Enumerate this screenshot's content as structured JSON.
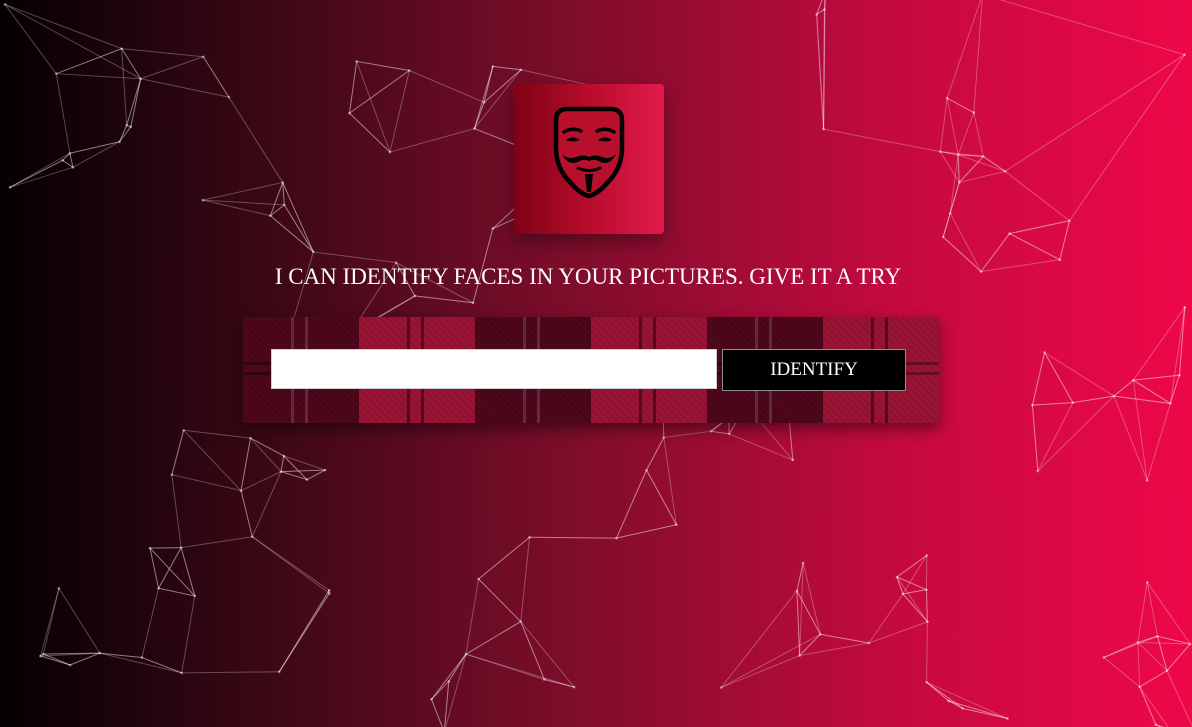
{
  "logo": {
    "icon": "guy-fawkes-mask-icon"
  },
  "headline": "I CAN IDENTIFY FACES IN YOUR PICTURES. GIVE IT A TRY",
  "search": {
    "value": "",
    "placeholder": ""
  },
  "identify_button": {
    "label": "IDENTIFY"
  },
  "colors": {
    "background_left": "#050003",
    "background_right": "#ee0848",
    "logo_box_left": "#7d0314",
    "logo_box_right": "#e31a4d",
    "button_bg": "#000000",
    "text": "#ffffff"
  }
}
